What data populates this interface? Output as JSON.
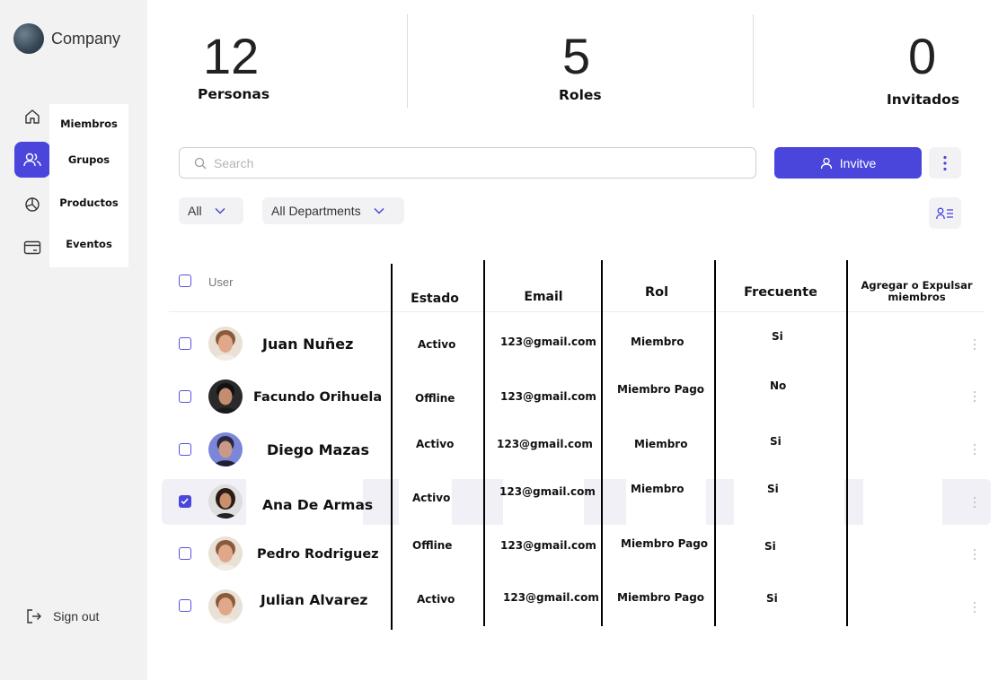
{
  "sidebar": {
    "company": "Company",
    "submenu": [
      "Miembros",
      "Grupos",
      "Productos",
      "Eventos"
    ],
    "signout": "Sign out"
  },
  "stats": [
    {
      "value": "12",
      "label": "Personas"
    },
    {
      "value": "5",
      "label": "Roles"
    },
    {
      "value": "0",
      "label": "Invitados"
    }
  ],
  "toolbar": {
    "search_placeholder": "Search",
    "invite_label": "Invitve",
    "filter_all": "All",
    "filter_departments": "All Departments"
  },
  "table": {
    "headers": {
      "user": "User",
      "estado": "Estado",
      "email": "Email",
      "rol": "Rol",
      "frecuente": "Frecuente",
      "agregar_line1": "Agregar o Expulsar",
      "agregar_line2": "miembros"
    },
    "rows": [
      {
        "name": "Juan Nuñez",
        "estado": "Activo",
        "email": "123@gmail.com",
        "rol": "Miembro",
        "frecuente": "Si",
        "checked": false
      },
      {
        "name": "Facundo Orihuela",
        "estado": "Offline",
        "email": "123@gmail.com",
        "rol": "Miembro Pago",
        "frecuente": "No",
        "checked": false
      },
      {
        "name": "Diego Mazas",
        "estado": "Activo",
        "email": "123@gmail.com",
        "rol": "Miembro",
        "frecuente": "Si",
        "checked": false
      },
      {
        "name": "Ana De Armas",
        "estado": "Activo",
        "email": "123@gmail.com",
        "rol": "Miembro",
        "frecuente": "Si",
        "checked": true
      },
      {
        "name": "Pedro Rodriguez",
        "estado": "Offline",
        "email": "123@gmail.com",
        "rol": "Miembro Pago",
        "frecuente": "Si",
        "checked": false
      },
      {
        "name": "Julian Alvarez",
        "estado": "Activo",
        "email": "123@gmail.com",
        "rol": "Miembro Pago",
        "frecuente": "Si",
        "checked": false
      }
    ]
  },
  "colors": {
    "accent": "#4a46dc",
    "sidebar_bg": "#f2f2f2",
    "selected_row_bg": "#f0f0f6"
  }
}
